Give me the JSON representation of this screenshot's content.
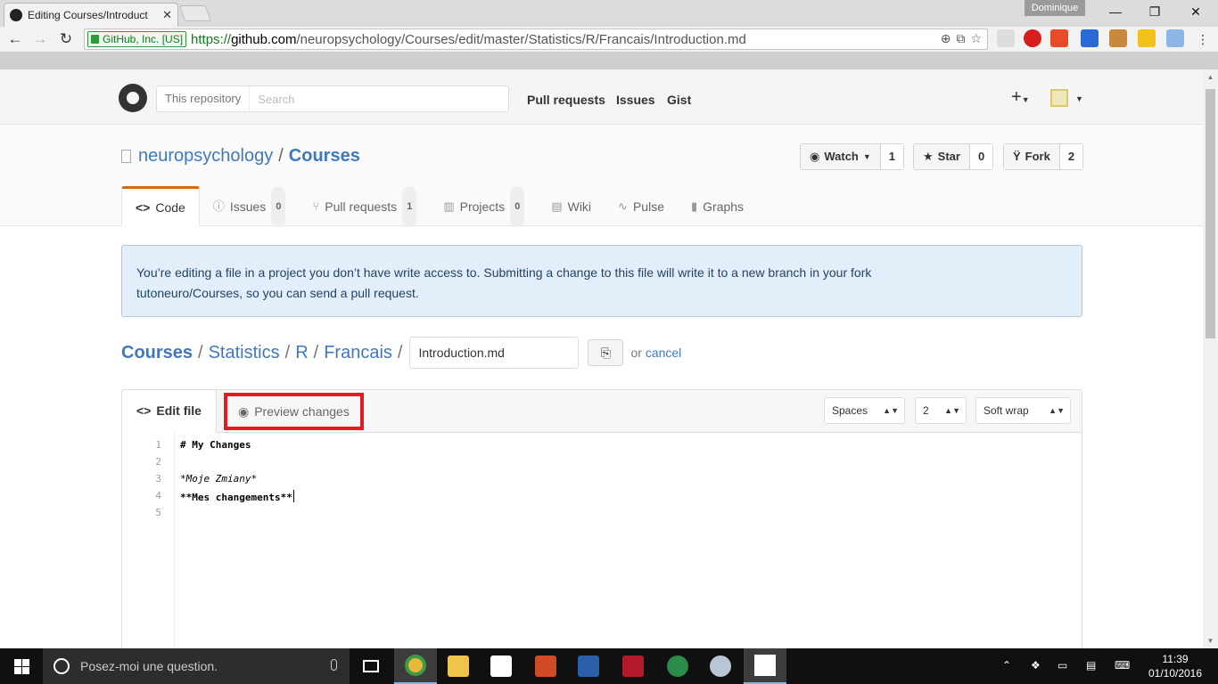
{
  "browser": {
    "tab_title": "Editing Courses/Introduct",
    "profile_name": "Dominique",
    "security_label": "GitHub, Inc. [US]",
    "url_scheme": "https://",
    "url_host": "github.com",
    "url_path": "/neuropsychology/Courses/edit/master/Statistics/R/Francais/Introduction.md",
    "icons": [
      "back-icon",
      "forward-icon",
      "reload-icon",
      "zoom-icon",
      "translate-icon",
      "star-icon"
    ]
  },
  "github": {
    "search_scope": "This repository",
    "search_placeholder": "Search",
    "nav": [
      "Pull requests",
      "Issues",
      "Gist"
    ],
    "plus_label": "+"
  },
  "repo": {
    "owner": "neuropsychology",
    "name": "Courses",
    "watch_label": "Watch",
    "watch_count": "1",
    "star_label": "Star",
    "star_count": "0",
    "fork_label": "Fork",
    "fork_count": "2",
    "tabs": [
      {
        "label": "Code",
        "count": ""
      },
      {
        "label": "Issues",
        "count": "0"
      },
      {
        "label": "Pull requests",
        "count": "1"
      },
      {
        "label": "Projects",
        "count": "0"
      },
      {
        "label": "Wiki",
        "count": ""
      },
      {
        "label": "Pulse",
        "count": ""
      },
      {
        "label": "Graphs",
        "count": ""
      }
    ]
  },
  "flash": {
    "line1": "You’re editing a file in a project you don’t have write access to. Submitting a change to this file will write it to a new branch in your fork",
    "line2": "tutoneuro/Courses, so you can send a pull request."
  },
  "breadcrumb": {
    "root": "Courses",
    "parts": [
      "Statistics",
      "R",
      "Francais"
    ],
    "filename": "Introduction.md",
    "or_text": "or",
    "cancel_label": "cancel"
  },
  "editor": {
    "edit_tab": "Edit file",
    "preview_tab": "Preview changes",
    "indent_mode": "Spaces",
    "indent_size": "2",
    "wrap_mode": "Soft wrap",
    "lines": [
      {
        "num": "1",
        "text": "# My Changes"
      },
      {
        "num": "2",
        "text": ""
      },
      {
        "num": "3",
        "text": "*Moje Zmiany*"
      },
      {
        "num": "4",
        "text": ""
      },
      {
        "num": "5",
        "text": "**Mes changements**"
      }
    ]
  },
  "taskbar": {
    "search_placeholder": "Posez-moi une question.",
    "time": "11:39",
    "date": "01/10/2016"
  }
}
